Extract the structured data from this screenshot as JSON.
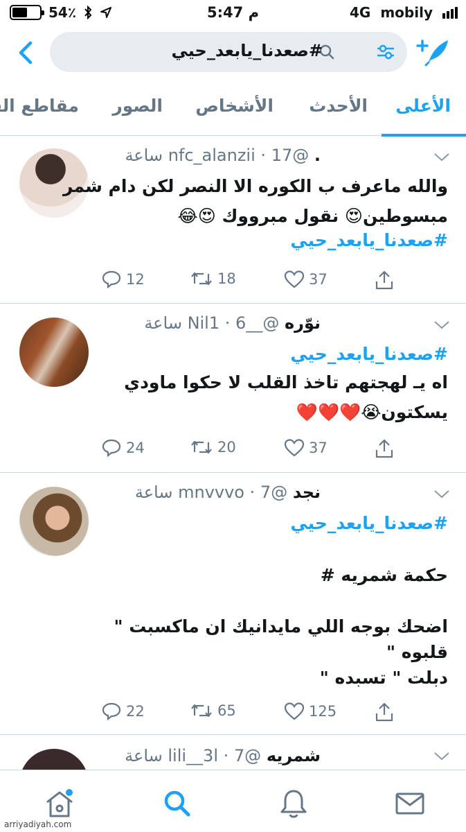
{
  "status_bar": {
    "battery": "54٪",
    "battery_level": 0.54,
    "time": "5:47 م",
    "network": "4G",
    "carrier": "mobily"
  },
  "search": {
    "query": "#صعدنا_يابعد_حيي"
  },
  "tabs": [
    {
      "label": "الأعلى",
      "active": true
    },
    {
      "label": "الأحدث",
      "active": false
    },
    {
      "label": "الأشخاص",
      "active": false
    },
    {
      "label": "الصور",
      "active": false
    },
    {
      "label": "مقاطع الف",
      "active": false
    }
  ],
  "tweets": [
    {
      "name": ".",
      "handle": "@nfc_alanzii",
      "time": "17 ساعة",
      "lines": [
        "والله ماعرف ب الكوره الا النصر لكن دام شمر",
        "مبسوطين😍 نقول مبرووك    😍😂"
      ],
      "hashtag_bottom": "#صعدنا_يابعد_حيي",
      "replies": "12",
      "retweets": "18",
      "likes": "37"
    },
    {
      "name": "نوّره",
      "handle": "@__Nil1",
      "time": "6 ساعة",
      "hashtag_top": "#صعدنا_يابعد_حيي",
      "lines": [
        "اه يـ لهجتهم تاخذ القلب لا حكوا ماودي",
        "يسكتون😭❤️❤️❤️"
      ],
      "replies": "24",
      "retweets": "20",
      "likes": "37"
    },
    {
      "name": "نجد",
      "handle": "@mnvvvo",
      "time": "7 ساعة",
      "hashtag_top": "#صعدنا_يابعد_حيي",
      "lines": [
        "حكمة شمريه  #",
        "",
        "اضحك بوجه اللي مايدانيك ان ماكسبت  \"",
        "قلبوه \"",
        "دبلت \" تسبده \""
      ],
      "replies": "22",
      "retweets": "65",
      "likes": "125"
    },
    {
      "name": "شمريه",
      "handle": "@lili__3l",
      "time": "7 ساعة"
    }
  ],
  "bottom_nav": [
    {
      "icon": "home-icon"
    },
    {
      "icon": "search-icon"
    },
    {
      "icon": "bell-icon"
    },
    {
      "icon": "mail-icon"
    }
  ],
  "watermark": "arriyadiyah.com"
}
